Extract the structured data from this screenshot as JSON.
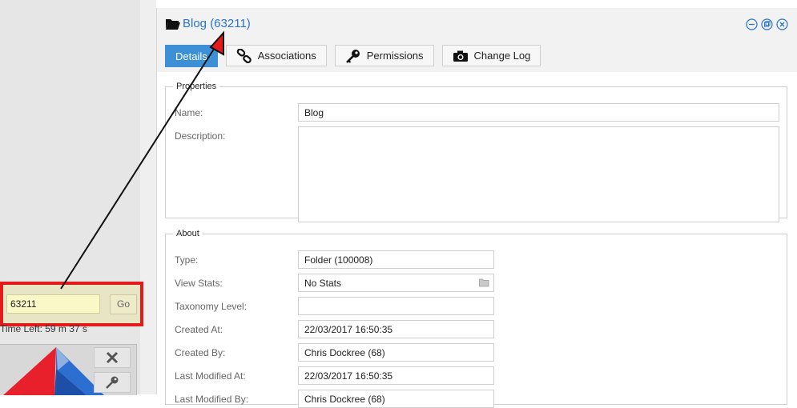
{
  "dialog": {
    "title": "Blog (63211)",
    "tabs": [
      {
        "label": "Details",
        "icon": "none",
        "active": true
      },
      {
        "label": "Associations",
        "icon": "link-icon"
      },
      {
        "label": "Permissions",
        "icon": "key-icon"
      },
      {
        "label": "Change Log",
        "icon": "camera-icon"
      }
    ]
  },
  "properties": {
    "legend": "Properties",
    "name_label": "Name:",
    "name_value": "Blog",
    "description_label": "Description:",
    "description_value": ""
  },
  "about": {
    "legend": "About",
    "rows": [
      {
        "label": "Type:",
        "value": "Folder (100008)"
      },
      {
        "label": "View Stats:",
        "value": "No Stats"
      },
      {
        "label": "Taxonomy Level:",
        "value": ""
      },
      {
        "label": "Created At:",
        "value": "22/03/2017 16:50:35"
      },
      {
        "label": "Created By:",
        "value": "Chris Dockree (68)"
      },
      {
        "label": "Last Modified At:",
        "value": "22/03/2017 16:50:35"
      },
      {
        "label": "Last Modified By:",
        "value": "Chris Dockree (68)"
      }
    ]
  },
  "quick_open": {
    "id_value": "63211",
    "go_label": "Go",
    "time_left": "Time Left: 59 m 37 s"
  },
  "colors": {
    "accent": "#3d8fd6",
    "title_link": "#2a73c8",
    "highlight_border": "#e21a1a",
    "input_yellow": "#fbf8c7"
  }
}
